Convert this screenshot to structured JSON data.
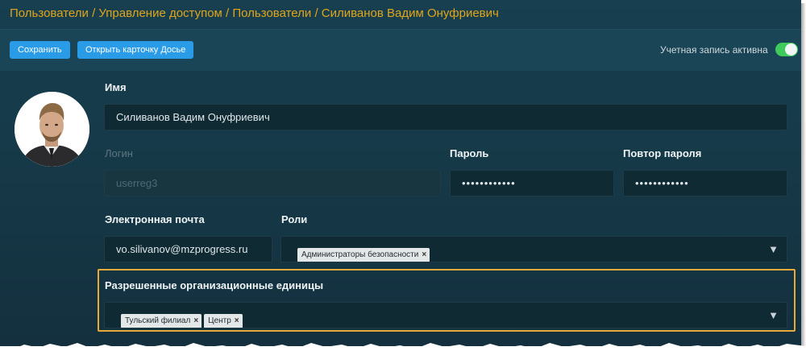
{
  "breadcrumb": "Пользователи / Управление доступом / Пользователи / Силиванов Вадим Онуфриевич",
  "toolbar": {
    "save_label": "Сохранить",
    "open_card_label": "Открыть карточку Досье",
    "account_active_label": "Учетная запись активна",
    "account_active": true
  },
  "form": {
    "name_label": "Имя",
    "name_value": "Силиванов Вадим Онуфриевич",
    "login_label": "Логин",
    "login_value": "userreg3",
    "password_label": "Пароль",
    "password_value": "••••••••••••",
    "password_repeat_label": "Повтор пароля",
    "password_repeat_value": "••••••••••••",
    "email_label": "Электронная почта",
    "email_value": "vo.silivanov@mzprogress.ru",
    "roles_label": "Роли",
    "roles": [
      "Администраторы безопасности"
    ],
    "org_units_label": "Разрешенные организационные единицы",
    "org_units": [
      "Тульский филиал",
      "Центр"
    ]
  },
  "icons": {
    "dropdown": "chevron-down-icon",
    "remove": "close-icon",
    "avatar": "user-photo"
  },
  "colors": {
    "accent": "#2a9be6",
    "breadcrumb": "#e0a51a",
    "toggle_on": "#3ecb5c",
    "highlight": "#e8a83a"
  }
}
